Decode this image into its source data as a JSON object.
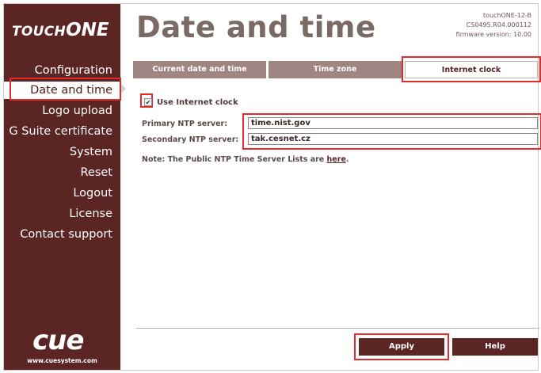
{
  "brand": {
    "touch": "TOUCH",
    "one": "ONE"
  },
  "sidebar": {
    "items": [
      {
        "label": "Configuration"
      },
      {
        "label": "Date and time"
      },
      {
        "label": "Logo upload"
      },
      {
        "label": "G Suite certificate"
      },
      {
        "label": "System"
      },
      {
        "label": "Reset"
      },
      {
        "label": "Logout"
      },
      {
        "label": "License"
      },
      {
        "label": "Contact support"
      }
    ],
    "active_index": 1,
    "logo": "cue",
    "url": "www.cuesystem.com"
  },
  "header": {
    "title": "Date and time",
    "device_name": "touchONE-12-B",
    "device_id": "CS0495.R04.000112",
    "firmware": "firmware version: 10.00"
  },
  "tabs": [
    {
      "label": "Current date and time",
      "selected": false
    },
    {
      "label": "Time zone",
      "selected": false
    },
    {
      "label": "Internet clock",
      "selected": true
    }
  ],
  "form": {
    "use_internet_clock_label": "Use Internet clock",
    "use_internet_clock_checked": true,
    "check_glyph": "✔",
    "primary_label": "Primary NTP server:",
    "primary_value": "time.nist.gov",
    "secondary_label": "Secondary NTP server:",
    "secondary_value": "tak.cesnet.cz",
    "note_prefix": "Note: The Public NTP Time Server Lists are ",
    "note_link": "here",
    "note_suffix": "."
  },
  "footer": {
    "apply_label": "Apply",
    "help_label": "Help"
  },
  "colors": {
    "sidebar_bg": "#5a2522",
    "tab_bg": "#a08682",
    "highlight": "#e52a2a",
    "title": "#7a6a66"
  }
}
